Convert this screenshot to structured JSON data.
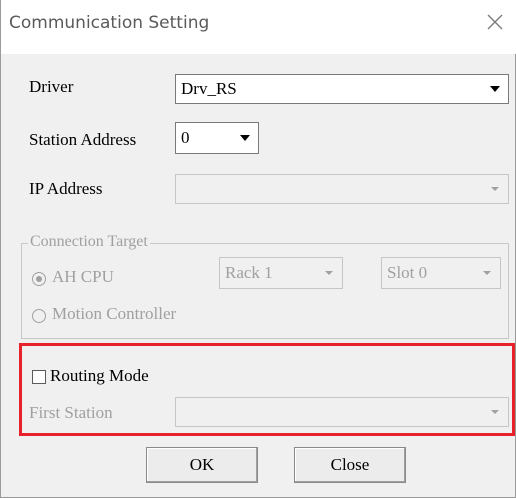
{
  "window": {
    "title": "Communication Setting"
  },
  "fields": {
    "driver": {
      "label": "Driver",
      "value": "Drv_RS"
    },
    "station_address": {
      "label": "Station Address",
      "value": "0"
    },
    "ip_address": {
      "label": "IP Address",
      "value": ""
    }
  },
  "connection_target": {
    "legend": "Connection Target",
    "ah_cpu_label": "AH CPU",
    "ah_cpu_selected": true,
    "rack_value": "Rack 1",
    "slot_value": "Slot 0",
    "motion_controller_label": "Motion Controller",
    "motion_controller_selected": false
  },
  "routing": {
    "checkbox_label": "Routing Mode",
    "checked": false,
    "first_station_label": "First Station",
    "first_station_value": ""
  },
  "buttons": {
    "ok_label": "OK",
    "close_label": "Close"
  },
  "colors": {
    "highlight": "#e8222a",
    "disabled_text": "#a0a0a0",
    "dialog_background": "#f0f0f0"
  },
  "icons": {
    "window_close": "close-icon",
    "dropdown": "chevron-down-icon"
  }
}
